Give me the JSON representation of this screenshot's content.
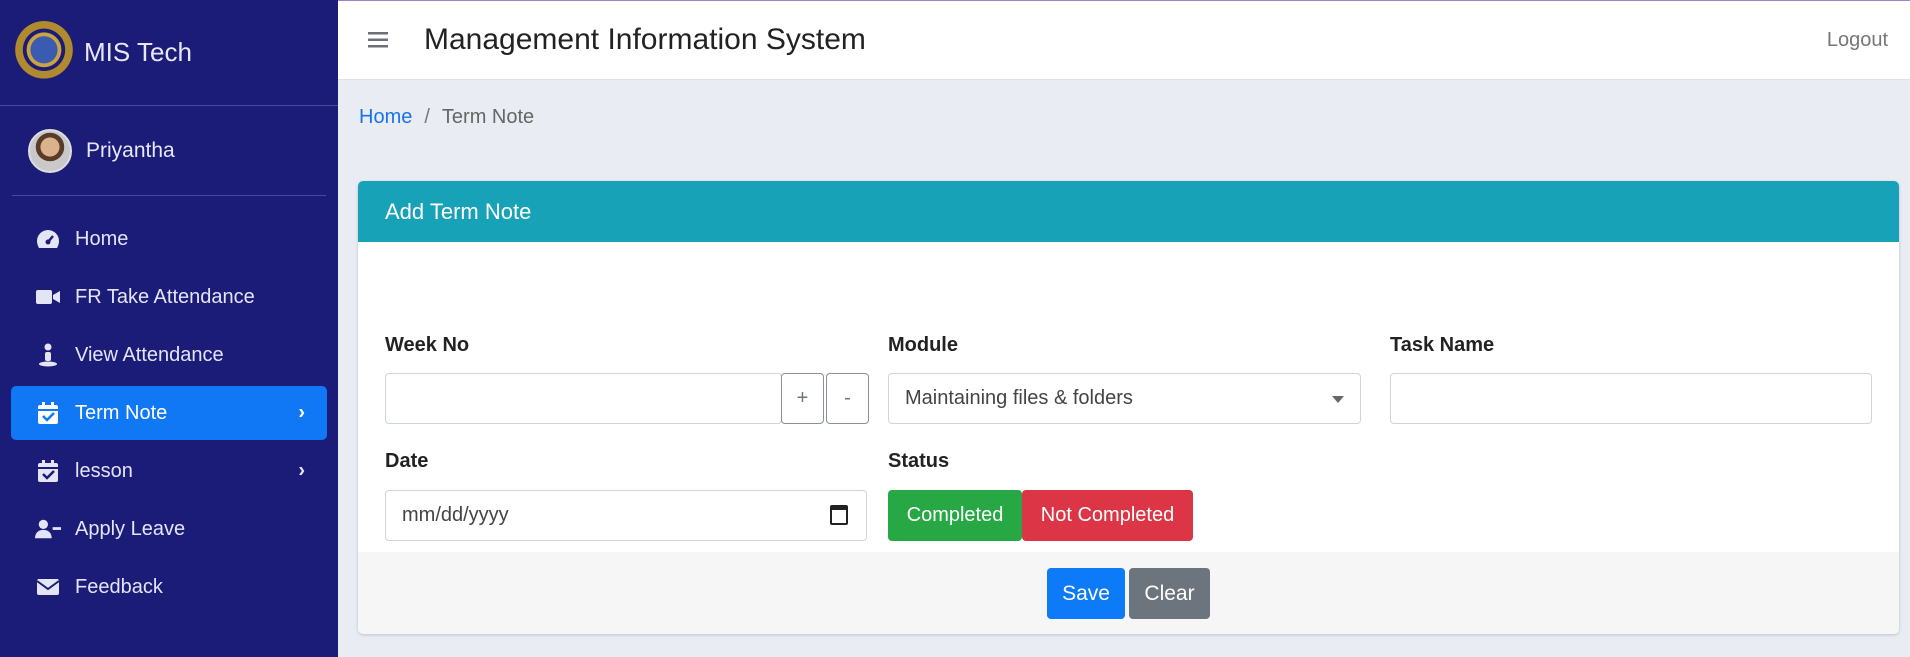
{
  "brand": {
    "name": "MIS Tech"
  },
  "user": {
    "name": "Priyantha"
  },
  "nav": [
    {
      "label": "Home",
      "icon": "dashboard-gauge-icon"
    },
    {
      "label": "FR Take Attendance",
      "icon": "video-camera-icon"
    },
    {
      "label": "View Attendance",
      "icon": "person-standing-icon"
    },
    {
      "label": "Term Note",
      "icon": "calendar-check-icon",
      "active": true
    },
    {
      "label": "lesson",
      "icon": "calendar-check-icon"
    },
    {
      "label": "Apply Leave",
      "icon": "user-minus-icon"
    },
    {
      "label": "Feedback",
      "icon": "envelope-icon"
    }
  ],
  "header": {
    "title": "Management Information System",
    "logout": "Logout"
  },
  "breadcrumb": {
    "home": "Home",
    "separator": "/",
    "current": "Term Note"
  },
  "form": {
    "title": "Add Term Note",
    "week_no": {
      "label": "Week No",
      "value": "",
      "plus": "+",
      "minus": "-"
    },
    "module": {
      "label": "Module",
      "selected": "Maintaining files & folders"
    },
    "task_name": {
      "label": "Task Name",
      "value": ""
    },
    "date": {
      "label": "Date",
      "placeholder": "mm/dd/yyyy"
    },
    "status": {
      "label": "Status",
      "completed": "Completed",
      "not_completed": "Not Completed"
    },
    "save": "Save",
    "clear": "Clear"
  },
  "colors": {
    "sidebar": "#1b1b78",
    "nav_active": "#1178f5",
    "card_header": "#18a2b8",
    "completed": "#28a745",
    "not_completed": "#dc3545",
    "save": "#0d7bf8",
    "clear": "#6c757d"
  }
}
